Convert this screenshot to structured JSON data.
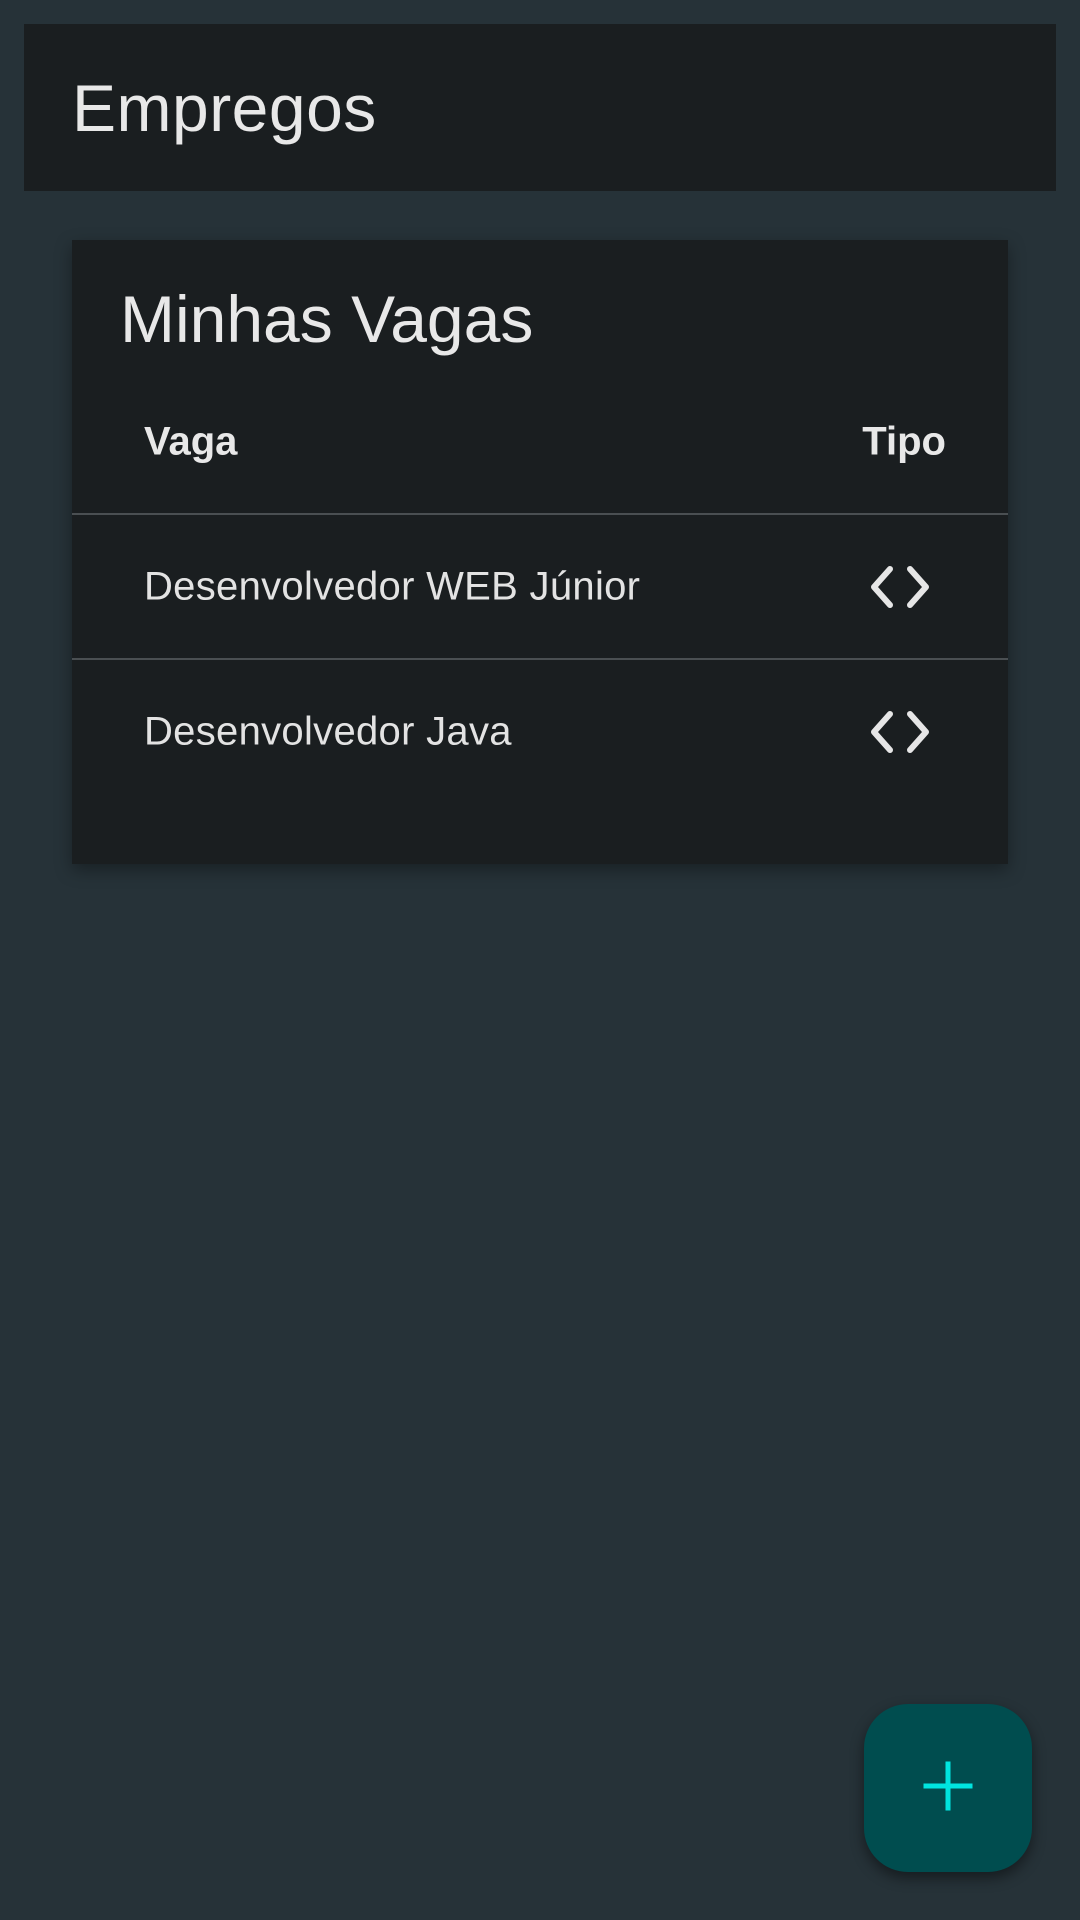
{
  "app_bar": {
    "title": "Empregos"
  },
  "card": {
    "title": "Minhas Vagas",
    "columns": {
      "vaga": "Vaga",
      "tipo": "Tipo"
    },
    "rows": [
      {
        "vaga": "Desenvolvedor WEB Júnior",
        "tipo_icon": "code-icon"
      },
      {
        "vaga": "Desenvolvedor Java",
        "tipo_icon": "code-icon"
      }
    ]
  },
  "fab": {
    "icon": "plus-icon",
    "icon_color": "#00e5e0",
    "background": "#004d4f"
  },
  "colors": {
    "background": "#263238",
    "surface": "#1a1e20",
    "text": "#e6e6e6"
  }
}
